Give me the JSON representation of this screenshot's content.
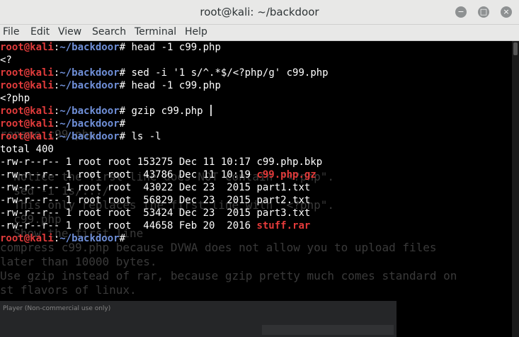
{
  "window": {
    "title": "root@kali: ~/backdoor",
    "buttons": {
      "minimize": "−",
      "maximize": "□",
      "close": "×"
    }
  },
  "menu": [
    "File",
    "Edit",
    "View",
    "Search",
    "Terminal",
    "Help"
  ],
  "terminal": {
    "prompt_user": "root@kali",
    "prompt_path": "~/backdoor",
    "lines": [
      {
        "type": "prompt",
        "cmd": " head -1 c99.php"
      },
      {
        "type": "out",
        "text": "<?"
      },
      {
        "type": "prompt",
        "cmd": " sed -i '1 s/^.*$/<?php/g' c99.php"
      },
      {
        "type": "prompt",
        "cmd": " head -1 c99.php"
      },
      {
        "type": "out",
        "text": "<?php"
      },
      {
        "type": "prompt",
        "cmd": " gzip c99.php"
      },
      {
        "type": "prompt",
        "cmd": ""
      },
      {
        "type": "prompt",
        "cmd": " ls -l"
      },
      {
        "type": "out",
        "text": "total 400"
      },
      {
        "type": "ls",
        "perm": "-rw-r--r-- 1 root root 153275 Dec 11 10:17 ",
        "file": "c99.php.bkp",
        "hl": false
      },
      {
        "type": "ls",
        "perm": "-rw-r--r-- 1 root root  43786 Dec 11 10:19 ",
        "file": "c99.php.gz",
        "hl": true
      },
      {
        "type": "ls",
        "perm": "-rw-r--r-- 1 root root  43022 Dec 23  2015 ",
        "file": "part1.txt",
        "hl": false
      },
      {
        "type": "ls",
        "perm": "-rw-r--r-- 1 root root  56829 Dec 23  2015 ",
        "file": "part2.txt",
        "hl": false
      },
      {
        "type": "ls",
        "perm": "-rw-r--r-- 1 root root  53424 Dec 23  2015 ",
        "file": "part3.txt",
        "hl": false
      },
      {
        "type": "ls",
        "perm": "-rw-r--r-- 1 root root  44658 Feb 20  2016 ",
        "file": "stuff.rar",
        "hl": true
      },
      {
        "type": "prompt",
        "cmd": ""
      }
    ],
    "ghost_lines": [
      "",
      "",
      "",
      "",
      "",
      "rename c99.php",
      "",
      "",
      "  Notice the first line does NOT contain \"<?php\".",
      "  sed -i 1s/.../",
      "  This only replaces the first line with \"<?php\".",
      "  c99.php",
      "  Show the first line                        ",
      "compress c99.php because DVWA does not allow you to upload files",
      "later than 10000 bytes.",
      "Use gzip instead of rar, because gzip pretty much comes standard on",
      "st flavors of linux."
    ]
  },
  "taskbar": {
    "label": "Player (Non-commercial use only)"
  }
}
